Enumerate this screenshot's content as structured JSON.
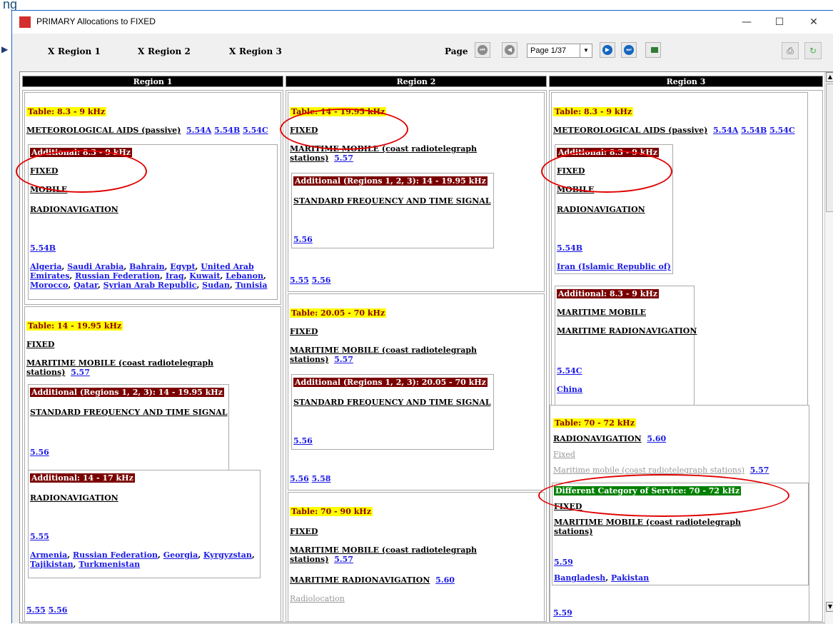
{
  "top_fragment": "ng",
  "window": {
    "title": "PRIMARY Allocations to FIXED",
    "minimize": "—",
    "maximize": "☐",
    "close": "✕"
  },
  "toolbar": {
    "checks": [
      {
        "label": "Region 1",
        "mark": "X"
      },
      {
        "label": "Region 2",
        "mark": "X"
      },
      {
        "label": "Region 3",
        "mark": "X"
      }
    ],
    "page_label": "Page",
    "page_value": "Page 1/37",
    "icons": [
      "first-page-icon",
      "prev-page-icon",
      "next-page-icon",
      "last-page-icon",
      "grid-icon",
      "print-icon",
      "refresh-icon"
    ]
  },
  "regions": [
    "Region 1",
    "Region 2",
    "Region 3"
  ],
  "r1": {
    "b1": {
      "table": "Table:  8.3 - 9 kHz",
      "svc": "METEOROLOGICAL AIDS (passive)",
      "fns": [
        "5.54A",
        "5.54B",
        "5.54C"
      ],
      "add": {
        "title": "Additional:  8.3 - 9 kHz",
        "svcs": [
          "FIXED",
          "MOBILE",
          "RADIONAVIGATION"
        ],
        "fn": "5.54B",
        "countries_l1": [
          "Algeria",
          "Saudi Arabia",
          "Bahrain",
          "Egypt",
          "United Arab"
        ],
        "countries_l2": [
          "Emirates",
          "Russian Federation",
          "Iraq",
          "Kuwait",
          "Lebanon"
        ],
        "countries_l3": [
          "Morocco",
          "Qatar",
          "Syrian Arab Republic",
          "Sudan",
          "Tunisia"
        ]
      }
    },
    "b2": {
      "table": "Table:  14 - 19.95 kHz",
      "svc1": "FIXED",
      "svc2_l1": "MARITIME MOBILE (coast radiotelegraph",
      "svc2_l2": "stations)",
      "fn2": "5.57",
      "add1": {
        "title": "Additional (Regions 1, 2, 3):  14 - 19.95 kHz",
        "svc": "STANDARD FREQUENCY AND TIME SIGNAL",
        "fn": "5.56"
      },
      "add2": {
        "title": "Additional:  14 - 17 kHz",
        "svc": "RADIONAVIGATION",
        "fn": "5.55",
        "countries_l1": [
          "Armenia",
          "Russian Federation",
          "Georgia",
          "Kyrgyzstan"
        ],
        "countries_l2": [
          "Tajikistan",
          "Turkmenistan"
        ]
      },
      "fns_bottom": [
        "5.55",
        "5.56"
      ]
    }
  },
  "r2": {
    "b1": {
      "table": "Table:  14 - 19.95 kHz",
      "svc1": "FIXED",
      "svc2_l1": "MARITIME MOBILE (coast radiotelegraph",
      "svc2_l2": "stations)",
      "fn2": "5.57",
      "add": {
        "title": "Additional (Regions 1, 2, 3):  14 - 19.95 kHz",
        "svc": "STANDARD FREQUENCY AND TIME SIGNAL",
        "fn": "5.56"
      },
      "fns_bottom": [
        "5.55",
        "5.56"
      ]
    },
    "b2": {
      "table": "Table:  20.05 - 70 kHz",
      "svc1": "FIXED",
      "svc2_l1": "MARITIME MOBILE (coast radiotelegraph",
      "svc2_l2": "stations)",
      "fn2": "5.57",
      "add": {
        "title": "Additional (Regions 1, 2, 3):  20.05 - 70 kHz",
        "svc": "STANDARD FREQUENCY AND TIME SIGNAL",
        "fn": "5.56"
      },
      "fns_bottom": [
        "5.56",
        "5.58"
      ]
    },
    "b3": {
      "table": "Table:  70 - 90 kHz",
      "svc1": "FIXED",
      "svc2_l1": "MARITIME MOBILE (coast radiotelegraph",
      "svc2_l2": "stations)",
      "fn2": "5.57",
      "svc3": "MARITIME RADIONAVIGATION",
      "fn3": "5.60",
      "secondary": "Radiolocation"
    }
  },
  "r3": {
    "b1": {
      "table": "Table:  8.3 - 9 kHz",
      "svc": "METEOROLOGICAL AIDS (passive)",
      "fns": [
        "5.54A",
        "5.54B",
        "5.54C"
      ],
      "add1": {
        "title": "Additional:  8.3 - 9 kHz",
        "svcs": [
          "FIXED",
          "MOBILE",
          "RADIONAVIGATION"
        ],
        "fn": "5.54B",
        "country": "Iran (Islamic Republic of)"
      },
      "add2": {
        "title": "Additional:  8.3 - 9 kHz",
        "svcs": [
          "MARITIME MOBILE",
          "MARITIME RADIONAVIGATION"
        ],
        "fn": "5.54C",
        "country": "China"
      }
    },
    "b2": {
      "table": "Table:  70 - 72 kHz",
      "svc1": "RADIONAVIGATION",
      "fn1": "5.60",
      "sec1": "Fixed",
      "sec2": "Maritime mobile (coast radiotelegraph stations)",
      "sec2_fn": "5.57",
      "diff": {
        "title": "Different Category of Service:  70 - 72 kHz",
        "svc1": "FIXED",
        "svc2_l1": "MARITIME MOBILE (coast radiotelegraph",
        "svc2_l2": "stations)",
        "fn": "5.59",
        "countries": [
          "Bangladesh",
          "Pakistan"
        ]
      },
      "fn_bottom": "5.59"
    }
  }
}
